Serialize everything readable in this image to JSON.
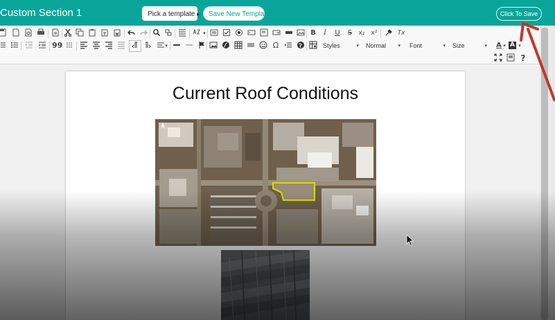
{
  "header": {
    "title": "Custom Section 1",
    "pick_template_label": "Pick a template",
    "pick_template_caret": "▸",
    "save_new_template_label": "Save New Template",
    "click_to_save_label": "Click To Save",
    "accent_color": "#0aa59a"
  },
  "toolbar": {
    "combos": {
      "styles": "Styles",
      "format": "Normal",
      "font": "Font",
      "size": "Size",
      "arrow": "▾"
    },
    "glyphs": {
      "bold": "B",
      "italic": "I",
      "underline": "U",
      "strike": "S",
      "subscript": "x₂",
      "superscript": "x²",
      "remove_format": "Tx",
      "blockquote": "99",
      "omega": "Ω",
      "help": "?",
      "text_color": "A",
      "bg_color": "A",
      "caret": "▾"
    }
  },
  "document": {
    "title": "Current Roof Conditions"
  },
  "annotation": {
    "arrow_color": "#c0392b"
  }
}
